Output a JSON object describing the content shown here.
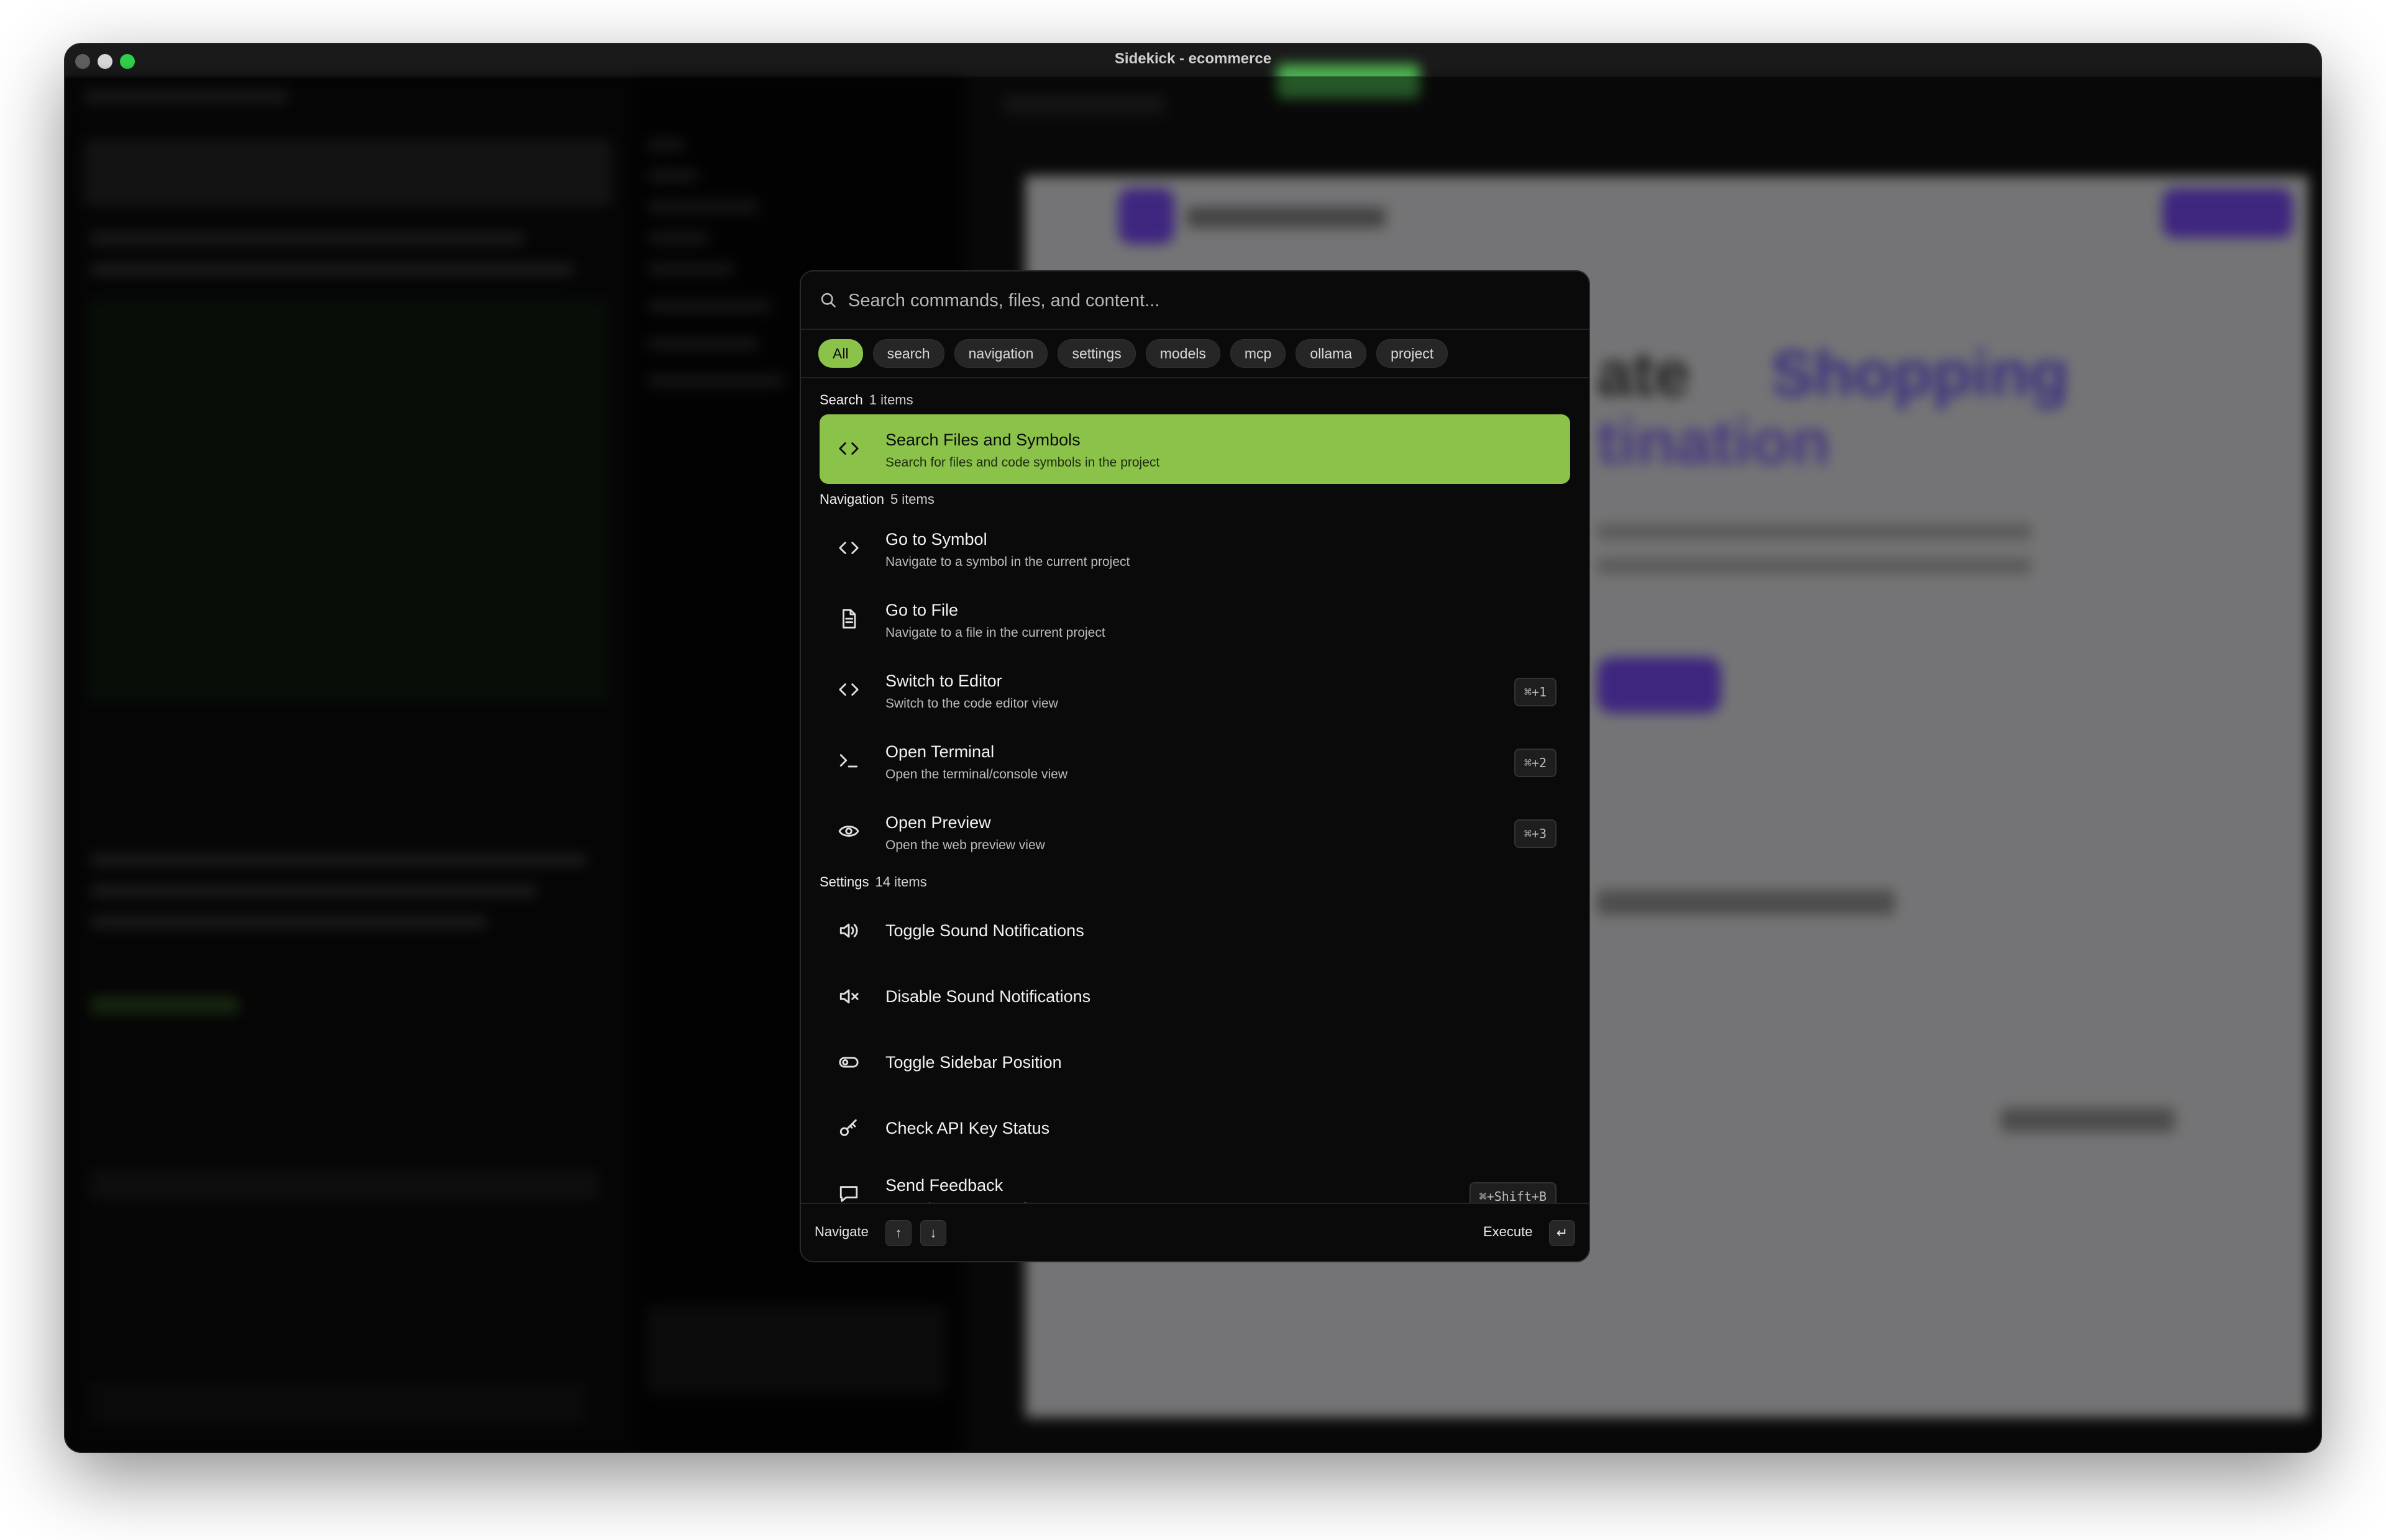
{
  "window": {
    "title": "Sidekick - ecommerce"
  },
  "search": {
    "placeholder": "Search commands, files, and content..."
  },
  "filters": [
    "All",
    "search",
    "navigation",
    "settings",
    "models",
    "mcp",
    "ollama",
    "project"
  ],
  "sections": [
    {
      "label": "Search",
      "count": "1 items",
      "items": [
        {
          "title": "Search Files and Symbols",
          "subtitle": "Search for files and code symbols in the project",
          "icon": "code-icon",
          "shortcut": ""
        }
      ]
    },
    {
      "label": "Navigation",
      "count": "5 items",
      "items": [
        {
          "title": "Go to Symbol",
          "subtitle": "Navigate to a symbol in the current project",
          "icon": "code-icon",
          "shortcut": ""
        },
        {
          "title": "Go to File",
          "subtitle": "Navigate to a file in the current project",
          "icon": "file-icon",
          "shortcut": ""
        },
        {
          "title": "Switch to Editor",
          "subtitle": "Switch to the code editor view",
          "icon": "code-icon",
          "shortcut": "⌘+1"
        },
        {
          "title": "Open Terminal",
          "subtitle": "Open the terminal/console view",
          "icon": "terminal-icon",
          "shortcut": "⌘+2"
        },
        {
          "title": "Open Preview",
          "subtitle": "Open the web preview view",
          "icon": "eye-icon",
          "shortcut": "⌘+3"
        }
      ]
    },
    {
      "label": "Settings",
      "count": "14 items",
      "items": [
        {
          "title": "Toggle Sound Notifications",
          "subtitle": "",
          "icon": "speaker-icon",
          "shortcut": ""
        },
        {
          "title": "Disable Sound Notifications",
          "subtitle": "",
          "icon": "speaker-muted-icon",
          "shortcut": ""
        },
        {
          "title": "Toggle Sidebar Position",
          "subtitle": "",
          "icon": "toggle-icon",
          "shortcut": ""
        },
        {
          "title": "Check API Key Status",
          "subtitle": "",
          "icon": "key-icon",
          "shortcut": ""
        },
        {
          "title": "Send Feedback",
          "subtitle": "Report bugs or request features",
          "icon": "message-icon",
          "shortcut": "⌘+Shift+B"
        }
      ]
    }
  ],
  "footer": {
    "navigate_label": "Navigate",
    "up_key": "↑",
    "down_key": "↓",
    "execute_label": "Execute",
    "enter_key": "↵"
  },
  "colors": {
    "accent": "#8bc34a",
    "background": "#0a0a0a",
    "chip": "#262626",
    "preview_accent": "#7c4dff"
  }
}
